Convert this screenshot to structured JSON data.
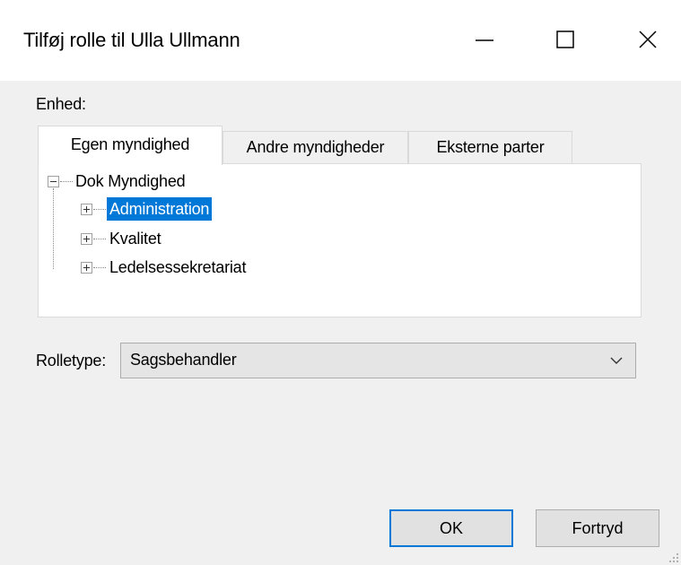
{
  "window": {
    "title": "Tilføj rolle til Ulla Ullmann",
    "controls": [
      "minimize-icon",
      "maximize-icon",
      "close-icon"
    ]
  },
  "unit": {
    "label": "Enhed:"
  },
  "tabs": [
    {
      "label": "Egen myndighed",
      "active": true
    },
    {
      "label": "Andre myndigheder",
      "active": false
    },
    {
      "label": "Eksterne parter",
      "active": false
    }
  ],
  "tree": {
    "root": {
      "label": "Dok Myndighed",
      "expanded": true
    },
    "children": [
      {
        "label": "Administration",
        "selected": true,
        "expanded": false
      },
      {
        "label": "Kvalitet",
        "selected": false,
        "expanded": false
      },
      {
        "label": "Ledelsessekretariat",
        "selected": false,
        "expanded": false
      }
    ],
    "selection_color": "#0078d7"
  },
  "role_type": {
    "label": "Rolletype:",
    "value": "Sagsbehandler"
  },
  "buttons": {
    "ok": "OK",
    "cancel": "Fortryd"
  }
}
